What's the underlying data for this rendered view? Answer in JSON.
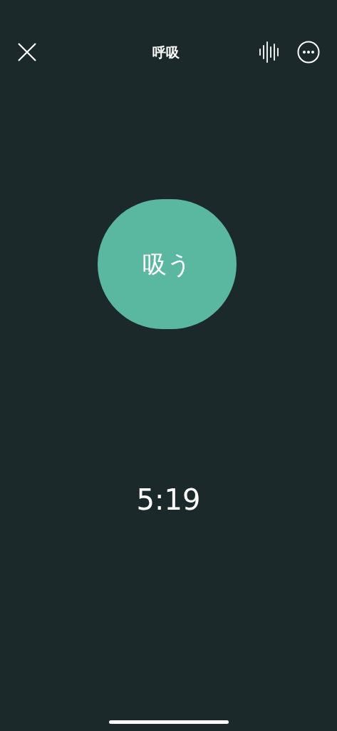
{
  "header": {
    "title": "呼吸"
  },
  "breath": {
    "phase": "吸う"
  },
  "timer": "5:19"
}
